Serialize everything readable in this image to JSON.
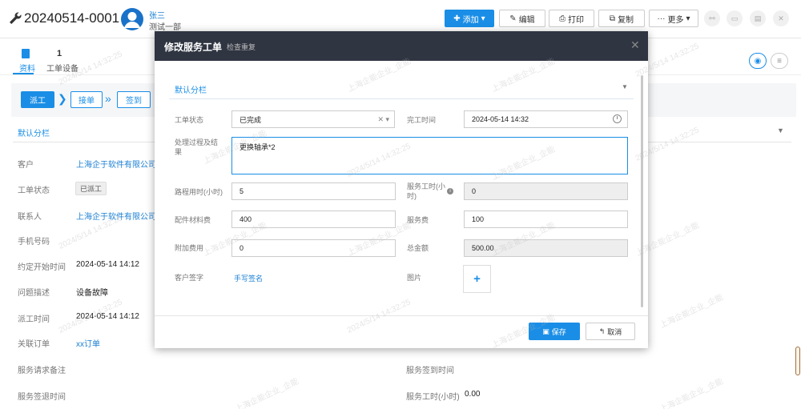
{
  "header": {
    "title": "20240514-0001",
    "user_name": "张三",
    "user_dept": "测试一部",
    "buttons": {
      "add": "添加",
      "edit": "编辑",
      "print": "打印",
      "copy": "复制",
      "more": "更多"
    }
  },
  "tabs": {
    "ziliao": "资料",
    "device_count": "1",
    "device": "工单设备"
  },
  "steps": [
    "派工",
    "接单",
    "签到"
  ],
  "section": {
    "title": "默认分栏"
  },
  "details": [
    {
      "label": "客户",
      "value": "上海企于软件有限公司",
      "kind": "link"
    },
    {
      "label": "工单状态",
      "value": "已派工",
      "kind": "tag"
    },
    {
      "label": "联系人",
      "value": "上海企于软件有限公司.联",
      "kind": "link"
    },
    {
      "label": "手机号码",
      "value": "",
      "kind": "text"
    },
    {
      "label": "约定开始时间",
      "value": "2024-05-14 14:12",
      "kind": "text"
    },
    {
      "label": "问题描述",
      "value": "设备故障",
      "kind": "text"
    },
    {
      "label": "派工时间",
      "value": "2024-05-14 14:12",
      "kind": "text"
    },
    {
      "label": "关联订单",
      "value": "xx订单",
      "kind": "link"
    },
    {
      "label": "服务请求备注",
      "value": "",
      "kind": "text"
    },
    {
      "label": "服务签退时间",
      "value": "",
      "kind": "text"
    }
  ],
  "details_right": {
    "checkin_label": "服务签到时间",
    "hours_label": "服务工时(小时)",
    "hours_value": "0.00"
  },
  "modal": {
    "title": "修改服务工单",
    "subtitle": "检查重复",
    "section_title": "默认分栏",
    "status_label": "工单状态",
    "status_value": "已完成",
    "finish_label": "完工时间",
    "finish_value": "2024-05-14 14:32",
    "process_label": "处理过程及结果",
    "process_value": "更换轴承*2",
    "travel_label": "路程用时(小时)",
    "travel_value": "5",
    "service_hours_label": "服务工时(小时)",
    "service_hours_value": "0",
    "parts_label": "配件材料费",
    "parts_value": "400",
    "service_fee_label": "服务费",
    "service_fee_value": "100",
    "extra_label": "附加费用",
    "extra_value": "0",
    "total_label": "总金额",
    "total_value": "500.00",
    "sign_label": "客户签字",
    "sign_value": "手写签名",
    "image_label": "图片",
    "save": "保存",
    "cancel": "取消"
  },
  "watermark": "上海企能企业_企能",
  "watermark_date": "2024/5/14 14:32:25",
  "colors": {
    "primary": "#1a8ee6",
    "modal_header": "#2f3541"
  }
}
